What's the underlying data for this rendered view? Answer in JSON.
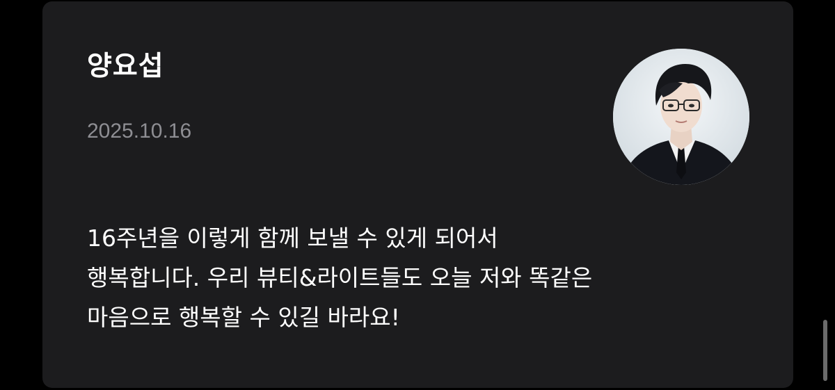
{
  "post": {
    "author": "양요섭",
    "date": "2025.10.16",
    "message_lines": [
      "16주년을 이렇게 함께 보낼 수 있게 되어서",
      "행복합니다. 우리 뷰티&라이트들도 오늘 저와 똑같은",
      "마음으로 행복할 수 있길 바라요!"
    ]
  },
  "colors": {
    "page_background": "#000000",
    "card_background": "#1c1c1e",
    "title_text": "#ffffff",
    "date_text": "#8e8e93",
    "body_text": "#ffffff",
    "scrollbar": "#6b6b6b"
  },
  "icons": {
    "avatar": "profile-photo"
  }
}
